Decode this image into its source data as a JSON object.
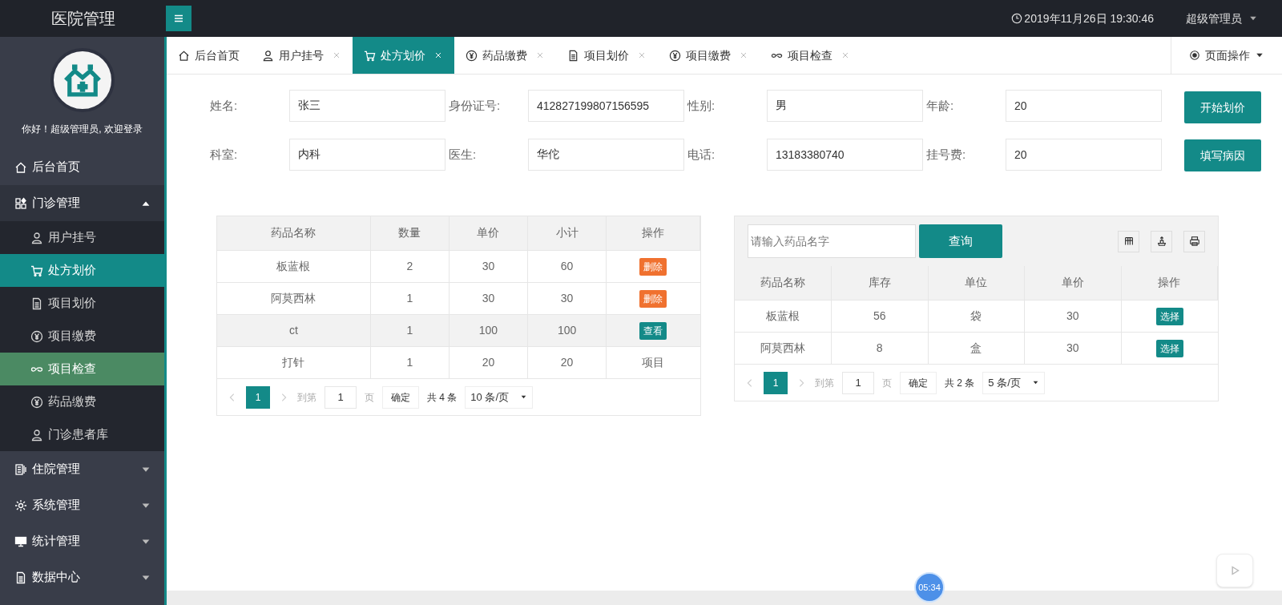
{
  "header": {
    "title": "医院管理",
    "time": "2019年11月26日 19:30:46",
    "user": "超级管理员"
  },
  "sidebar": {
    "greeting": "你好！超级管理员, 欢迎登录",
    "items": [
      {
        "label": "后台首页",
        "selected": false
      },
      {
        "label": "门诊管理",
        "expanded": true,
        "children": [
          {
            "label": "用户挂号",
            "selected": false,
            "highlighted": false
          },
          {
            "label": "处方划价",
            "selected": true,
            "highlighted": false
          },
          {
            "label": "项目划价",
            "selected": false,
            "highlighted": false
          },
          {
            "label": "项目缴费",
            "selected": false,
            "highlighted": false
          },
          {
            "label": "项目检查",
            "selected": false,
            "highlighted": true
          },
          {
            "label": "药品缴费",
            "selected": false,
            "highlighted": false
          },
          {
            "label": "门诊患者库",
            "selected": false,
            "highlighted": false
          }
        ]
      },
      {
        "label": "住院管理",
        "expanded": false
      },
      {
        "label": "系统管理",
        "expanded": false
      },
      {
        "label": "统计管理",
        "expanded": false
      },
      {
        "label": "数据中心",
        "expanded": false
      }
    ]
  },
  "tabs": [
    {
      "label": "后台首页",
      "selected": false,
      "closable": false
    },
    {
      "label": "用户挂号",
      "selected": false,
      "closable": true
    },
    {
      "label": "处方划价",
      "selected": true,
      "closable": true
    },
    {
      "label": "药品缴费",
      "selected": false,
      "closable": true
    },
    {
      "label": "项目划价",
      "selected": false,
      "closable": true
    },
    {
      "label": "项目缴费",
      "selected": false,
      "closable": true
    },
    {
      "label": "项目检查",
      "selected": false,
      "closable": true
    }
  ],
  "page_actions": "页面操作",
  "form": {
    "fields": [
      {
        "label": "姓名:",
        "value": "张三"
      },
      {
        "label": "身份证号:",
        "value": "412827199807156595"
      },
      {
        "label": "性别:",
        "value": "男"
      },
      {
        "label": "年龄:",
        "value": "20"
      },
      {
        "label": "科室:",
        "value": "内科"
      },
      {
        "label": "医生:",
        "value": "华佗"
      },
      {
        "label": "电话:",
        "value": "13183380740"
      },
      {
        "label": "挂号费:",
        "value": "20"
      }
    ],
    "buttons": [
      "开始划价",
      "填写病因"
    ]
  },
  "prescription_table": {
    "columns": [
      "药品名称",
      "数量",
      "单价",
      "小计",
      "操作"
    ],
    "rows": [
      {
        "cells": [
          "板蓝根",
          "2",
          "30",
          "60"
        ],
        "action": {
          "kind": "delete",
          "label": "删除"
        },
        "highlighted": false
      },
      {
        "cells": [
          "阿莫西林",
          "1",
          "30",
          "30"
        ],
        "action": {
          "kind": "delete",
          "label": "删除"
        },
        "highlighted": false
      },
      {
        "cells": [
          "ct",
          "1",
          "100",
          "100"
        ],
        "action": {
          "kind": "view",
          "label": "查看"
        },
        "highlighted": true
      },
      {
        "cells": [
          "打针",
          "1",
          "20",
          "20"
        ],
        "action": {
          "kind": "text",
          "label": "项目"
        },
        "highlighted": false
      }
    ],
    "pagination": {
      "page": "1",
      "goto_label": "到第",
      "goto_value": "1",
      "page_unit": "页",
      "confirm": "确定",
      "total": "共 4 条",
      "per_page": "10 条/页"
    }
  },
  "drug_search": {
    "placeholder": "请输入药品名字",
    "button": "查询",
    "columns": [
      "药品名称",
      "库存",
      "单位",
      "单价",
      "操作"
    ],
    "rows": [
      {
        "cells": [
          "板蓝根",
          "56",
          "袋",
          "30"
        ],
        "action": "选择"
      },
      {
        "cells": [
          "阿莫西林",
          "8",
          "盒",
          "30"
        ],
        "action": "选择"
      }
    ],
    "pagination": {
      "page": "1",
      "goto_label": "到第",
      "goto_value": "1",
      "page_unit": "页",
      "confirm": "确定",
      "total": "共 2 条",
      "per_page": "5 条/页"
    }
  },
  "timer": "05:34"
}
